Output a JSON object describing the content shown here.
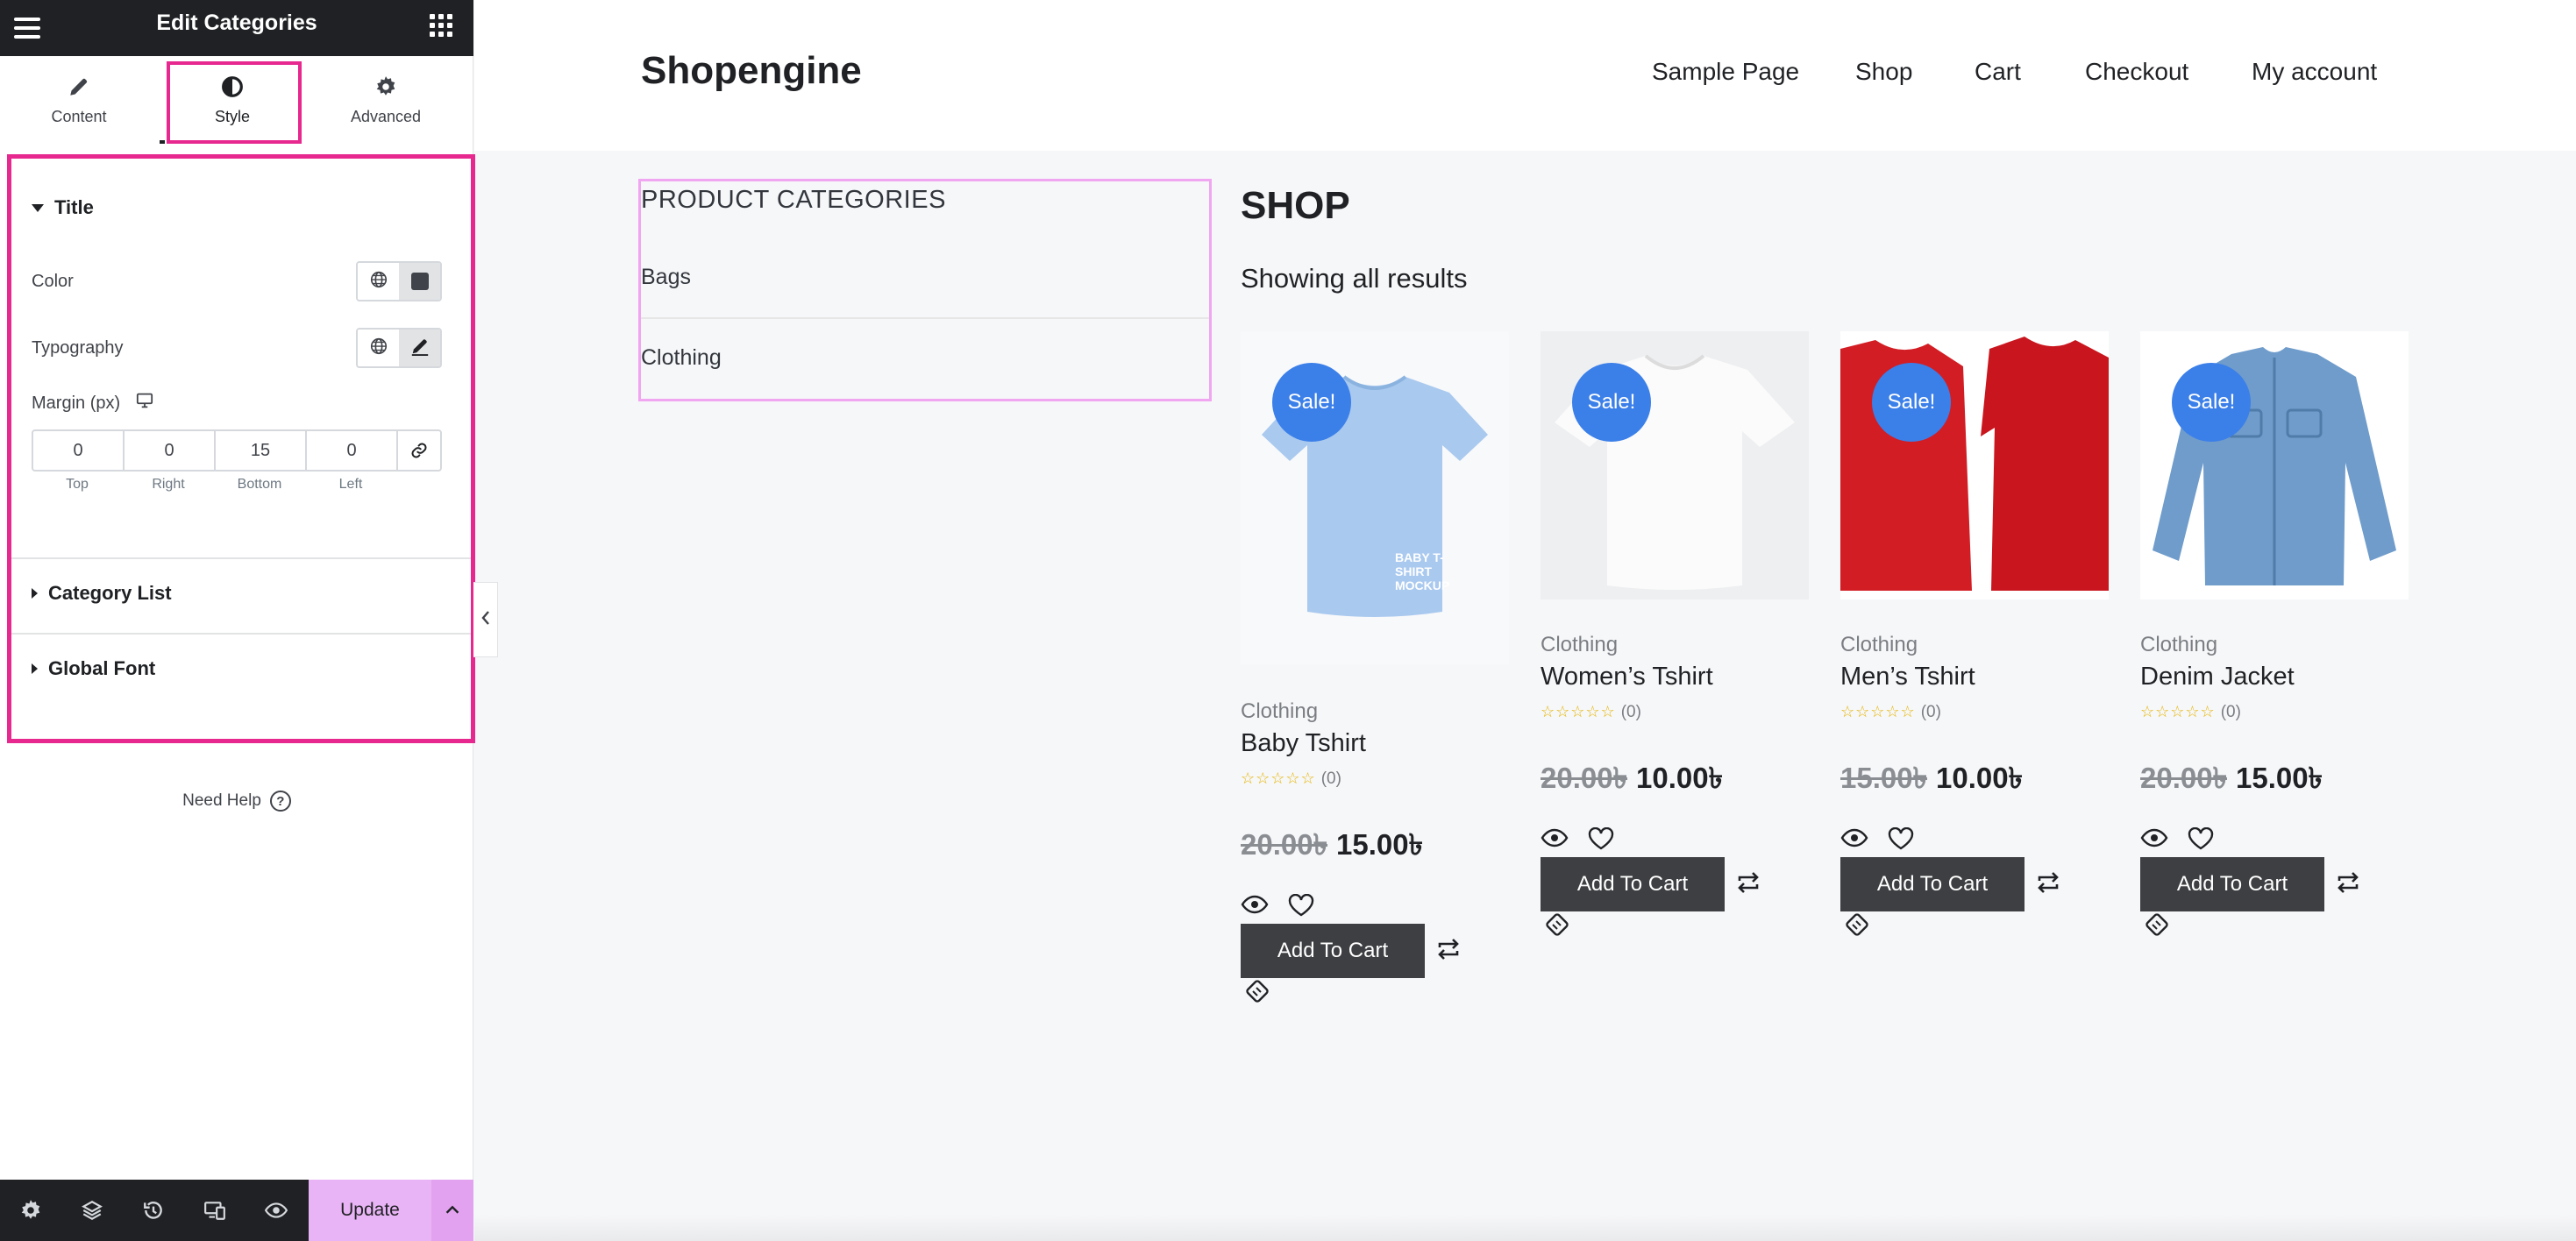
{
  "panel": {
    "title": "Edit Categories",
    "tabs": [
      {
        "label": "Content"
      },
      {
        "label": "Style"
      },
      {
        "label": "Advanced"
      }
    ],
    "title_section": {
      "label": "Title",
      "color_label": "Color",
      "typography_label": "Typography",
      "margin_label": "Margin (px)",
      "margin": {
        "top": "0",
        "right": "0",
        "bottom": "15",
        "left": "0"
      },
      "margin_labels": {
        "top": "Top",
        "right": "Right",
        "bottom": "Bottom",
        "left": "Left"
      }
    },
    "category_list_label": "Category List",
    "global_font_label": "Global Font",
    "need_help": "Need Help",
    "update_label": "Update"
  },
  "site": {
    "title": "Shopengine",
    "nav": [
      "Sample Page",
      "Shop",
      "Cart",
      "Checkout",
      "My account"
    ],
    "categories": {
      "title": "PRODUCT CATEGORIES",
      "items": [
        "Bags",
        "Clothing"
      ]
    },
    "shop": {
      "title": "SHOP",
      "results": "Showing all results",
      "sale_badge": "Sale!",
      "add_to_cart": "Add To Cart",
      "products": [
        {
          "category": "Clothing",
          "name": "Baby Tshirt",
          "rating_count": "(0)",
          "old_price": "20.00৳",
          "new_price": "15.00৳"
        },
        {
          "category": "Clothing",
          "name": "Women’s Tshirt",
          "rating_count": "(0)",
          "old_price": "20.00৳",
          "new_price": "10.00৳"
        },
        {
          "category": "Clothing",
          "name": "Men’s Tshirt",
          "rating_count": "(0)",
          "old_price": "15.00৳",
          "new_price": "10.00৳"
        },
        {
          "category": "Clothing",
          "name": "Denim Jacket",
          "rating_count": "(0)",
          "old_price": "20.00৳",
          "new_price": "15.00৳"
        }
      ],
      "baby_shirt_print": "BABY T-SHIRT MOCKUP"
    }
  },
  "colors": {
    "accent_highlight": "#e6288f",
    "category_highlight": "#f0a6f0",
    "sale_badge": "#3b7fe9",
    "update_button": "#e9b4f5",
    "add_to_cart": "#3e3f42"
  }
}
